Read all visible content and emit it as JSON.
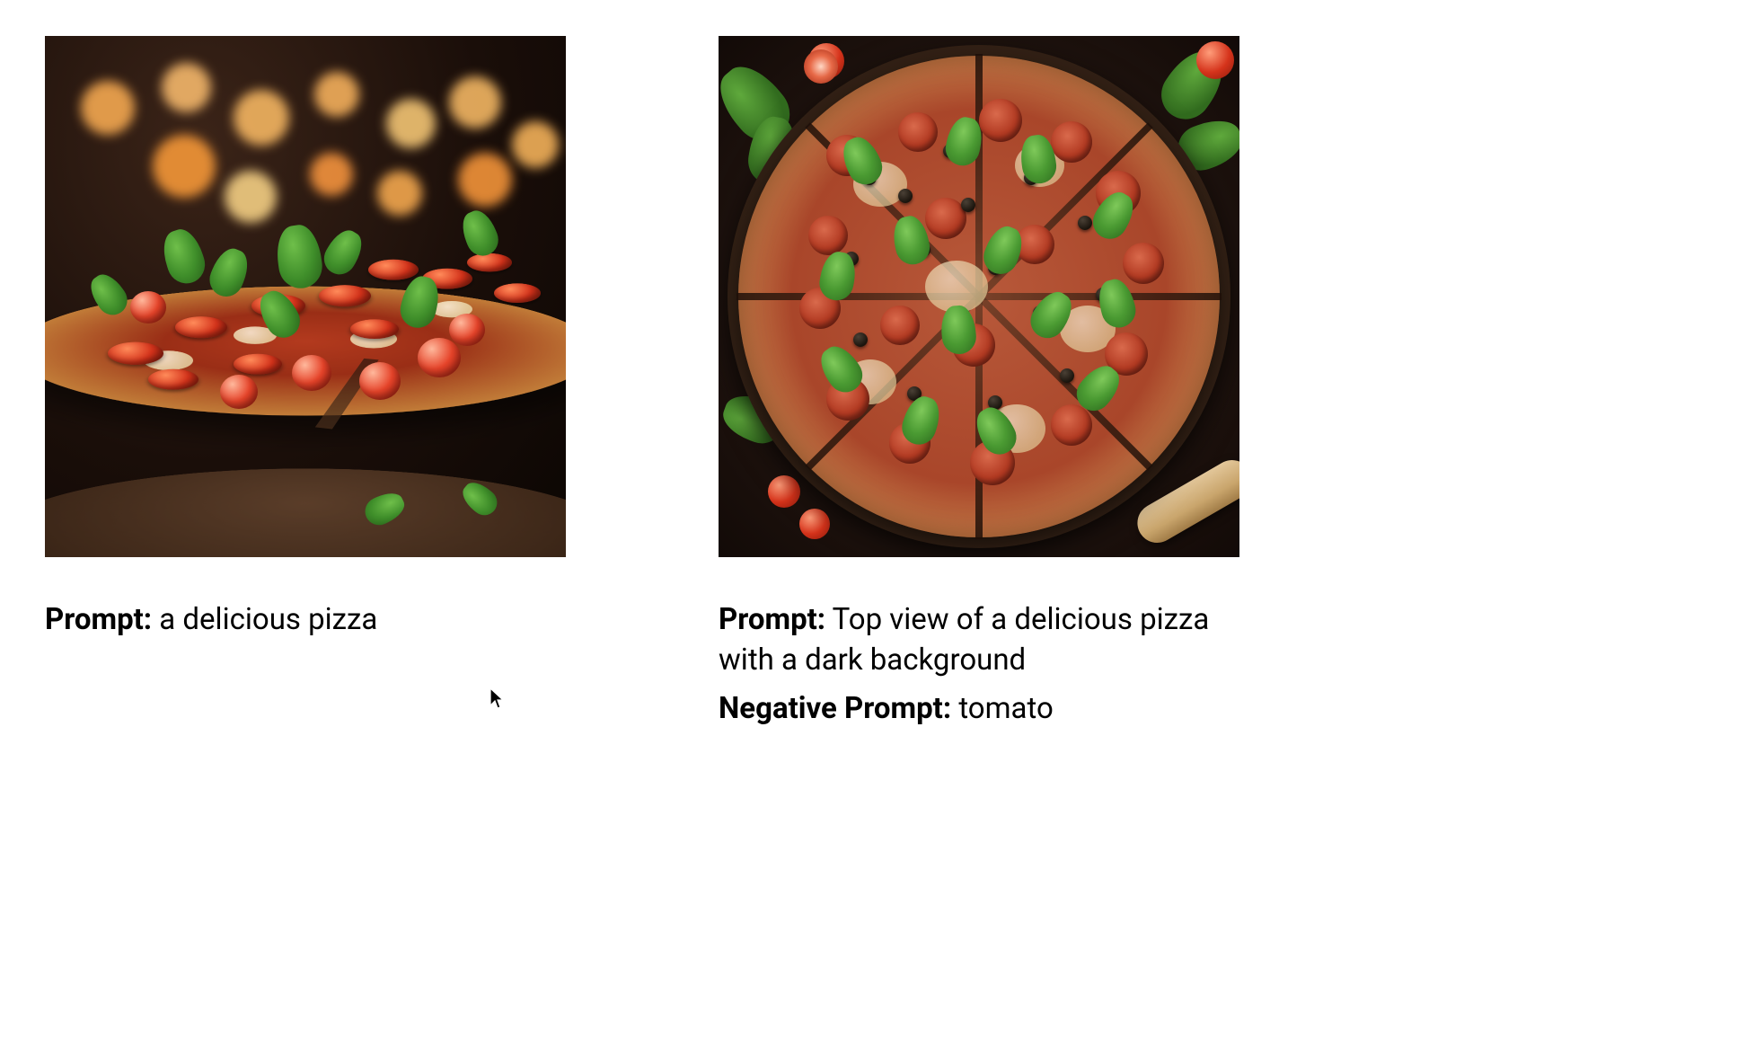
{
  "items": [
    {
      "image_alt": "Angled close-up of a pepperoni and basil pizza on a wooden board with warm bokeh lights in the background",
      "fields": [
        {
          "label": "Prompt:",
          "value": "a delicious pizza"
        }
      ]
    },
    {
      "image_alt": "Top-down view of a sliced pepperoni, olive and basil pizza on a dark wooden surface with scattered basil and cherry tomatoes",
      "fields": [
        {
          "label": "Prompt:",
          "value": "Top view of a delicious pizza with a dark background"
        },
        {
          "label": "Negative Prompt:",
          "value": "tomato"
        }
      ]
    }
  ]
}
